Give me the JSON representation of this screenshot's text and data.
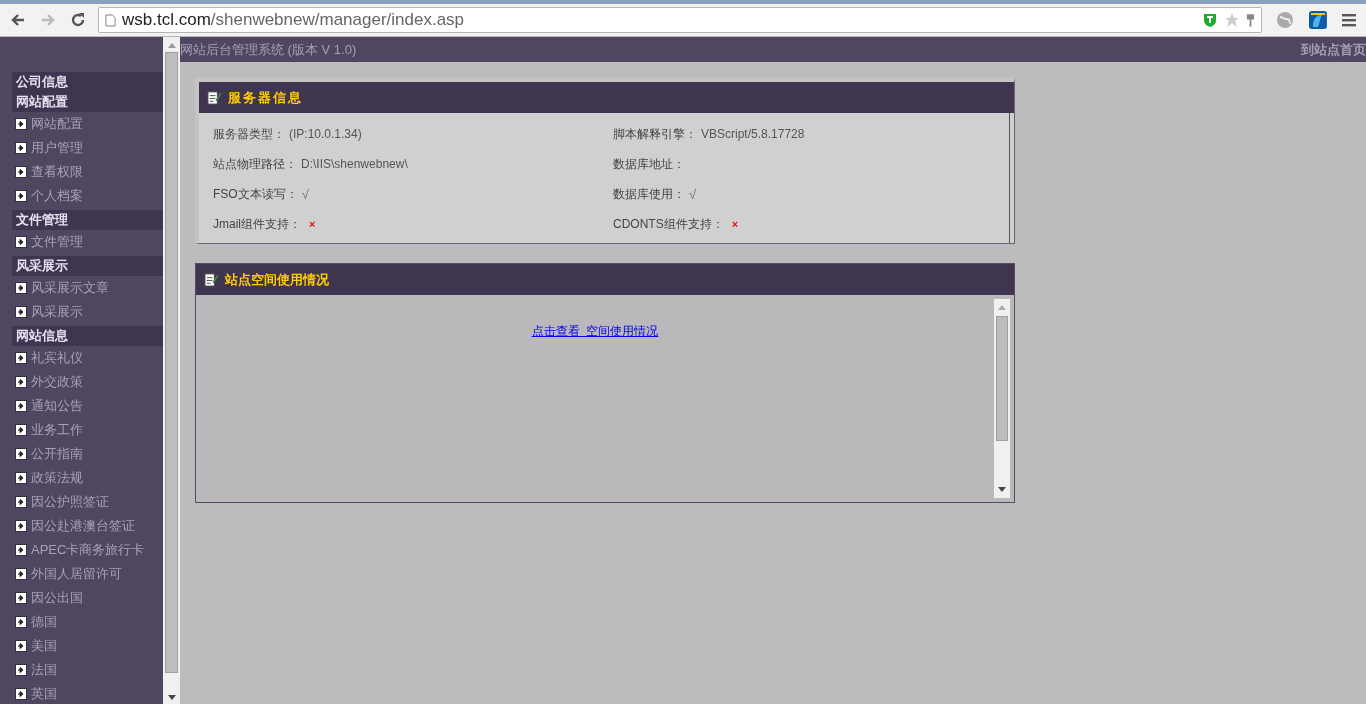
{
  "browser": {
    "url_host": "wsb.tcl.com",
    "url_path": "/shenwebnew/manager/index.asp",
    "forward_disabled": true
  },
  "top_bar": {
    "title": "网站后台管理系统 (版本 V 1.0)",
    "home_link": "到站点首页"
  },
  "sidebar": {
    "entries": [
      {
        "kind": "header",
        "label": "公司信息"
      },
      {
        "kind": "header",
        "label": "网站配置"
      },
      {
        "kind": "item",
        "label": "网站配置"
      },
      {
        "kind": "item",
        "label": "用户管理"
      },
      {
        "kind": "item",
        "label": "查看权限"
      },
      {
        "kind": "item",
        "label": "个人档案"
      },
      {
        "kind": "header",
        "label": "文件管理"
      },
      {
        "kind": "item",
        "label": "文件管理"
      },
      {
        "kind": "header",
        "label": "风采展示"
      },
      {
        "kind": "item",
        "label": "风采展示文章"
      },
      {
        "kind": "item",
        "label": "风采展示"
      },
      {
        "kind": "header",
        "label": "网站信息"
      },
      {
        "kind": "item",
        "label": "礼宾礼仪"
      },
      {
        "kind": "item",
        "label": "外交政策"
      },
      {
        "kind": "item",
        "label": "通知公告"
      },
      {
        "kind": "item",
        "label": "业务工作"
      },
      {
        "kind": "item",
        "label": "公开指南"
      },
      {
        "kind": "item",
        "label": "政策法规"
      },
      {
        "kind": "item",
        "label": "因公护照签证"
      },
      {
        "kind": "item",
        "label": "因公赴港澳台签证"
      },
      {
        "kind": "item",
        "label": "APEC卡商务旅行卡"
      },
      {
        "kind": "item",
        "label": "外国人居留许可"
      },
      {
        "kind": "item",
        "label": "因公出国"
      },
      {
        "kind": "item",
        "label": "德国"
      },
      {
        "kind": "item",
        "label": "美国"
      },
      {
        "kind": "item",
        "label": "法国"
      },
      {
        "kind": "item",
        "label": "英国"
      }
    ]
  },
  "server_panel": {
    "title": "服务器信息",
    "rows": [
      {
        "label": "服务器类型：",
        "value": "(IP:10.0.1.34)",
        "kind": "text"
      },
      {
        "label": "脚本解释引擎：",
        "value": "VBScript/5.8.17728",
        "kind": "text"
      },
      {
        "label": "站点物理路径：",
        "value": "D:\\IIS\\shenwebnew\\",
        "kind": "text"
      },
      {
        "label": "数据库地址："
      },
      {
        "label": "FSO文本读写：",
        "value": "√",
        "kind": "yes"
      },
      {
        "label": "数据库使用：",
        "value": "√",
        "kind": "yes"
      },
      {
        "label": "Jmail组件支持：",
        "value": "×",
        "kind": "no"
      },
      {
        "label": "CDONTS组件支持：",
        "value": "×",
        "kind": "no"
      }
    ]
  },
  "space_panel": {
    "title": "站点空间使用情况",
    "link": "点击查看  空间使用情况"
  }
}
